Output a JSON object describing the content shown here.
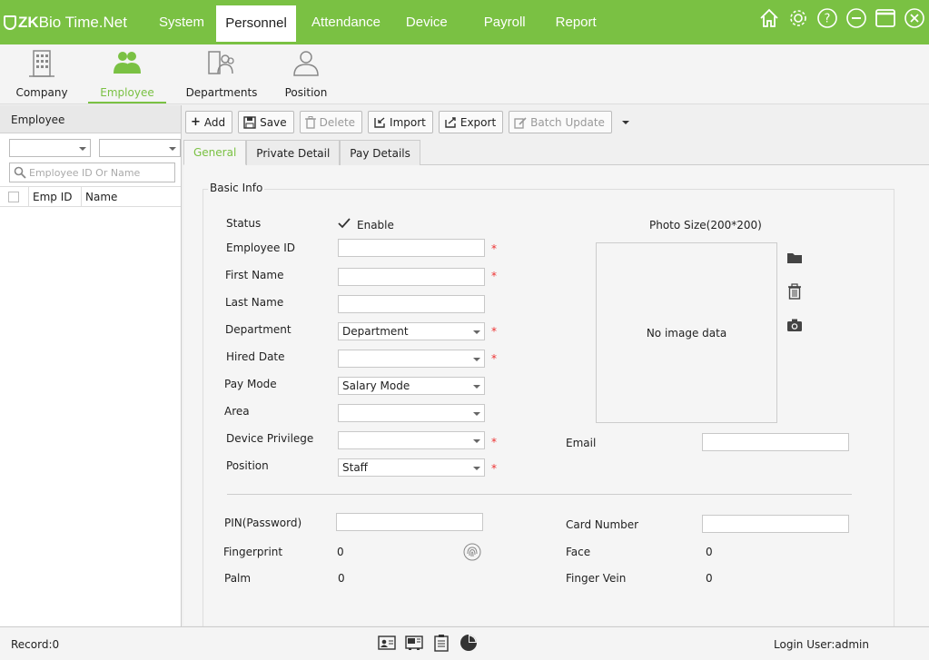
{
  "app": {
    "brand_prefix": "ZK",
    "brand_rest": "Bio Time.Net"
  },
  "nav": [
    "System",
    "Personnel",
    "Attendance",
    "Device",
    "Payroll",
    "Report"
  ],
  "window_icons": [
    "home-icon",
    "gear-icon",
    "help-icon",
    "minimize-icon",
    "maximize-icon",
    "close-icon"
  ],
  "subnav": [
    {
      "label": "Company",
      "icon": "company-icon"
    },
    {
      "label": "Employee",
      "icon": "employee-icon"
    },
    {
      "label": "Departments",
      "icon": "departments-icon"
    },
    {
      "label": "Position",
      "icon": "position-icon"
    }
  ],
  "left_panel": {
    "title": "Employee",
    "search_placeholder": "Employee ID Or Name",
    "columns": [
      "Emp ID",
      "Name"
    ]
  },
  "toolbar": {
    "add": "Add",
    "save": "Save",
    "delete": "Delete",
    "import": "Import",
    "export": "Export",
    "batch_update": "Batch Update"
  },
  "tabs": [
    "General",
    "Private Detail",
    "Pay Details"
  ],
  "form": {
    "section_title": "Basic Info",
    "status_label": "Status",
    "enable_label": "Enable",
    "employee_id_label": "Employee ID",
    "first_name_label": "First Name",
    "last_name_label": "Last Name",
    "department_label": "Department",
    "department_value": "Department",
    "hired_date_label": "Hired Date",
    "pay_mode_label": "Pay Mode",
    "pay_mode_value": "Salary Mode",
    "area_label": "Area",
    "device_privilege_label": "Device Privilege",
    "position_label": "Position",
    "position_value": "Staff",
    "photo_size_label": "Photo Size(200*200)",
    "no_image": "No image data",
    "email_label": "Email",
    "pin_label": "PIN(Password)",
    "card_number_label": "Card Number",
    "fingerprint_label": "Fingerprint",
    "fingerprint_value": "0",
    "face_label": "Face",
    "face_value": "0",
    "palm_label": "Palm",
    "palm_value": "0",
    "finger_vein_label": "Finger Vein",
    "finger_vein_value": "0",
    "required_mark": "*"
  },
  "status": {
    "record": "Record:0",
    "login_user": "Login User:admin"
  },
  "colors": {
    "accent": "#7ac143",
    "required": "#e33333"
  }
}
